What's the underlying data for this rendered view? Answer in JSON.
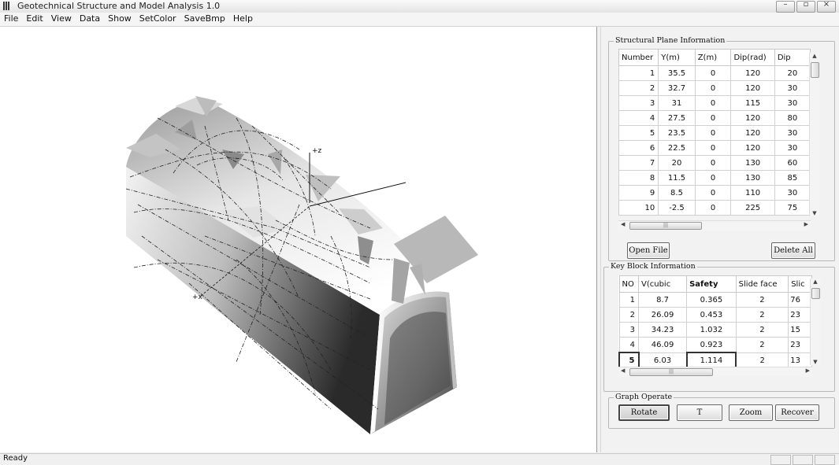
{
  "window": {
    "title": "Geotechnical Structure and Model Analysis 1.0",
    "controls": [
      "minimize-icon",
      "maximize-icon",
      "close-icon"
    ]
  },
  "menu": [
    "File",
    "Edit",
    "View",
    "Data",
    "Show",
    "SetColor",
    "SaveBmp",
    "Help"
  ],
  "viewport": {
    "axis_z_label": "+z",
    "axis_x_label": "+x"
  },
  "structural_plane": {
    "title": "Structural Plane Information",
    "columns": [
      "Number",
      "Y(m)",
      "Z(m)",
      "Dip(rad)",
      "Dip"
    ],
    "rows": [
      [
        "1",
        "35.5",
        "0",
        "120",
        "20"
      ],
      [
        "2",
        "32.7",
        "0",
        "120",
        "30"
      ],
      [
        "3",
        "31",
        "0",
        "115",
        "30"
      ],
      [
        "4",
        "27.5",
        "0",
        "120",
        "80"
      ],
      [
        "5",
        "23.5",
        "0",
        "120",
        "30"
      ],
      [
        "6",
        "22.5",
        "0",
        "120",
        "30"
      ],
      [
        "7",
        "20",
        "0",
        "130",
        "60"
      ],
      [
        "8",
        "11.5",
        "0",
        "130",
        "85"
      ],
      [
        "9",
        "8.5",
        "0",
        "110",
        "30"
      ],
      [
        "10",
        "-2.5",
        "0",
        "225",
        "75"
      ]
    ],
    "open_file_label": "Open File",
    "delete_all_label": "Delete All"
  },
  "key_block": {
    "title": "Key Block Information",
    "columns": [
      "NO",
      "V(cubic",
      "Safety",
      "Slide face",
      "Slic"
    ],
    "rows": [
      [
        "1",
        "8.7",
        "0.365",
        "2",
        "76"
      ],
      [
        "2",
        "26.09",
        "0.453",
        "2",
        "23"
      ],
      [
        "3",
        "34.23",
        "1.032",
        "2",
        "15"
      ],
      [
        "4",
        "46.09",
        "0.923",
        "2",
        "23"
      ],
      [
        "5",
        "6.03",
        "1.114",
        "2",
        "13"
      ]
    ],
    "selected_row": 5
  },
  "graph_operate": {
    "title": "Graph Operate",
    "buttons": [
      "Rotate",
      "T",
      "Zoom",
      "Recover"
    ]
  },
  "status": {
    "text": "Ready"
  }
}
